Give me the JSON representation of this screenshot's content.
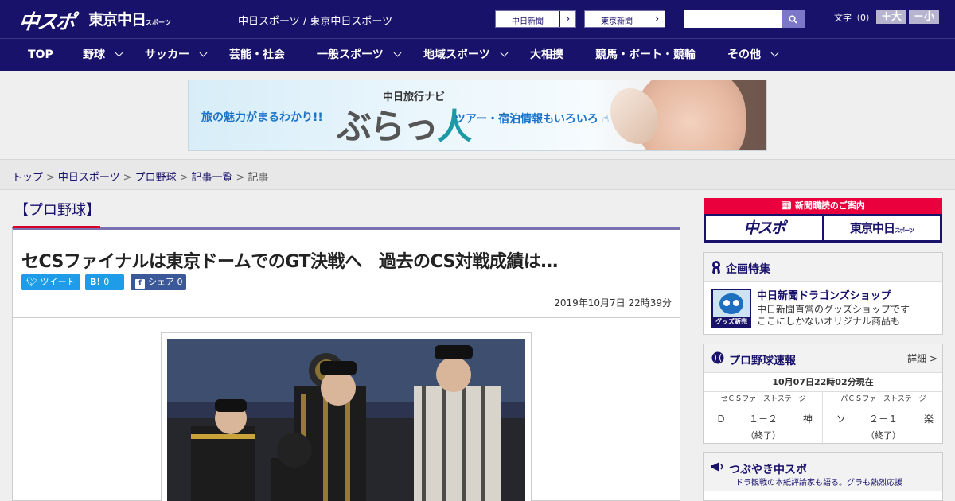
{
  "header": {
    "logo_chuspo": "中スポ",
    "logo_tokyo": "東京中日",
    "logo_tokyo_suffix": "スポーツ",
    "site_title": "中日スポーツ / 東京中日スポーツ",
    "ext_links": [
      "中日新聞",
      "東京新聞"
    ],
    "search": {
      "placeholder": "",
      "value": ""
    },
    "font_size_label": "文字（0）",
    "size_up": "＋大",
    "size_down": "－小"
  },
  "nav": {
    "items": [
      {
        "label": "TOP",
        "has_dropdown": false
      },
      {
        "label": "野球",
        "has_dropdown": true
      },
      {
        "label": "サッカー",
        "has_dropdown": true
      },
      {
        "label": "芸能・社会",
        "has_dropdown": false
      },
      {
        "label": "一般スポーツ",
        "has_dropdown": true
      },
      {
        "label": "地域スポーツ",
        "has_dropdown": true
      },
      {
        "label": "大相撲",
        "has_dropdown": false
      },
      {
        "label": "競馬・ボート・競輪",
        "has_dropdown": false
      },
      {
        "label": "その他",
        "has_dropdown": true
      }
    ]
  },
  "ad": {
    "line1": "旅の魅力がまるわかり!!",
    "navi": "中日旅行ナビ",
    "brand_a": "ぶらっ",
    "brand_b": "人",
    "line2": "ツアー・宿泊情報もいろいろ"
  },
  "breadcrumb": [
    "トップ",
    "中日スポーツ",
    "プロ野球",
    "記事一覧",
    "記事"
  ],
  "breadcrumb_sep": ">",
  "category": "【プロ野球】",
  "article": {
    "headline": "セCSファイナルは東京ドームでのGT決戦へ　過去のCS対戦成績は…",
    "tweet_label": "ツイート",
    "hatena_label": "B!",
    "hatena_count": "0",
    "facebook_label": "シェア",
    "facebook_count": "0",
    "date": "2019年10月7日 22時39分"
  },
  "sidebar": {
    "subscription": {
      "header": "新聞購読のご案内",
      "logo_a": "中スポ",
      "logo_b": "東京中日",
      "logo_b_suffix": "スポーツ"
    },
    "kikaku": {
      "title": "企画特集",
      "item_title": "中日新聞ドラゴンズショップ",
      "item_desc1": "中日新聞直営のグッズショップです",
      "item_desc2": "ここにしかないオリジナル商品も",
      "thumb_label": "グッズ販売中"
    },
    "sokuhou": {
      "title": "プロ野球速報",
      "detail": "詳細 >",
      "status": "10月07日22時02分現在",
      "games": [
        {
          "stage": "セＣＳファーストステージ",
          "team1": "Ｄ",
          "score": "１－２",
          "team2": "神",
          "state": "（終了）"
        },
        {
          "stage": "パＣＳファーストステージ",
          "team1": "ソ",
          "score": "２－１",
          "team2": "楽",
          "state": "（終了）"
        }
      ]
    },
    "tsubuyaki": {
      "title": "つぶやき中スポ",
      "subtitle": "ドラ観戦の本紙評論家も語る。グラも熱烈応援"
    }
  },
  "colors": {
    "header_bg": "#19126b",
    "accent_red": "#d7002b",
    "twitter": "#1e9ce7",
    "facebook": "#3b5998"
  }
}
